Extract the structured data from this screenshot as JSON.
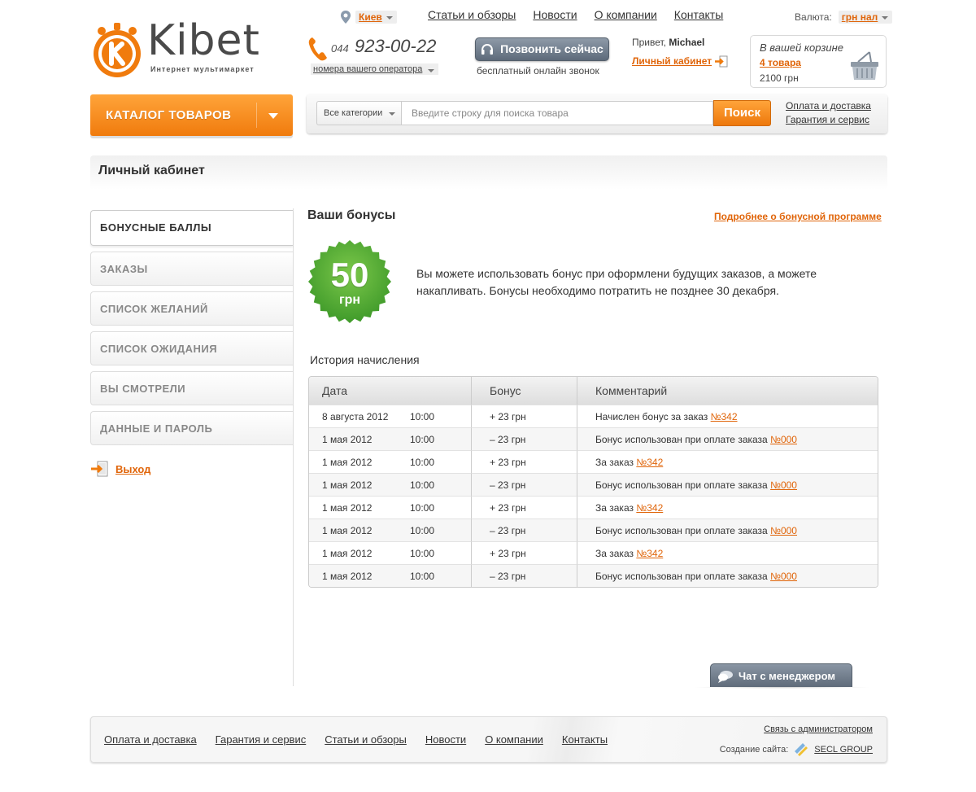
{
  "logo": {
    "name": "Kibet",
    "tagline": "Интернет мультимаркет"
  },
  "city": {
    "label": "Киев"
  },
  "top_nav": [
    "Статьи и обзоры",
    "Новости",
    "О компании",
    "Контакты"
  ],
  "currency": {
    "label": "Валюта:",
    "value": "грн нал"
  },
  "phone": {
    "code": "044",
    "number": "923-00-22",
    "operators": "номера вашего оператора"
  },
  "callback": {
    "button": "Позвонить сейчас",
    "note": "бесплатный онлайн звонок"
  },
  "user": {
    "greeting": "Привет,",
    "name": "Michael",
    "cabinet_link": "Личный кабинет"
  },
  "cart": {
    "title": "В вашей корзине",
    "count": "4 товара",
    "sum": "2100 грн"
  },
  "catalog": {
    "label": "КАТАЛОГ ТОВАРОВ"
  },
  "search": {
    "category": "Все категории",
    "placeholder": "Введите строку для поиска товара",
    "button": "Поиск",
    "links": [
      "Оплата и доставка",
      "Гарантия и сервис"
    ]
  },
  "page": {
    "title": "Личный кабинет"
  },
  "sidebar": {
    "items": [
      {
        "label": "БОНУСНЫЕ БАЛЛЫ",
        "active": true
      },
      {
        "label": "ЗАКАЗЫ",
        "active": false
      },
      {
        "label": "СПИСОК ЖЕЛАНИЙ",
        "active": false
      },
      {
        "label": "СПИСОК ОЖИДАНИЯ",
        "active": false
      },
      {
        "label": "ВЫ СМОТРЕЛИ",
        "active": false
      },
      {
        "label": "ДАННЫЕ И ПАРОЛЬ",
        "active": false
      }
    ],
    "logout": "Выход"
  },
  "bonus": {
    "title": "Ваши бонусы",
    "more_link": "Подробнее о бонусной программе",
    "amount": "50",
    "unit": "грн",
    "text": "Вы можете использовать бонус при оформлени будущих заказов, а можете накапливать. Бонусы необходимо потратить не позднее 30 декабря."
  },
  "history": {
    "title": "История начисления",
    "columns": [
      "Дата",
      "Бонус",
      "Комментарий"
    ],
    "rows": [
      {
        "date": "8 августа 2012",
        "time": "10:00",
        "bonus": "+ 23 грн",
        "comment": "Начислен бонус за заказ",
        "order": "№342"
      },
      {
        "date": "1 мая 2012",
        "time": "10:00",
        "bonus": "– 23 грн",
        "comment": "Бонус использован при оплате заказа",
        "order": "№000"
      },
      {
        "date": "1 мая 2012",
        "time": "10:00",
        "bonus": "+ 23 грн",
        "comment": "За заказ",
        "order": "№342"
      },
      {
        "date": "1 мая 2012",
        "time": "10:00",
        "bonus": "– 23 грн",
        "comment": "Бонус использован при оплате заказа",
        "order": "№000"
      },
      {
        "date": "1 мая 2012",
        "time": "10:00",
        "bonus": "+ 23 грн",
        "comment": "За заказ",
        "order": "№342"
      },
      {
        "date": "1 мая 2012",
        "time": "10:00",
        "bonus": "– 23 грн",
        "comment": "Бонус использован при оплате заказа",
        "order": "№000"
      },
      {
        "date": "1 мая 2012",
        "time": "10:00",
        "bonus": "+ 23 грн",
        "comment": "За заказ",
        "order": "№342"
      },
      {
        "date": "1 мая 2012",
        "time": "10:00",
        "bonus": "– 23 грн",
        "comment": "Бонус использован при оплате заказа",
        "order": "№000"
      }
    ]
  },
  "chat": {
    "label": "Чат с менеджером"
  },
  "footer": {
    "nav": [
      "Оплата и доставка",
      "Гарантия и сервис",
      "Статьи и обзоры",
      "Новости",
      "О компании",
      "Контакты"
    ],
    "admin_link": "Связь с администратором",
    "made_by_label": "Создание сайта:",
    "made_by_name": "SECL GROUP"
  },
  "colors": {
    "accent": "#f07b0d",
    "link": "#e0650a",
    "seal_green": "#5aa832"
  }
}
